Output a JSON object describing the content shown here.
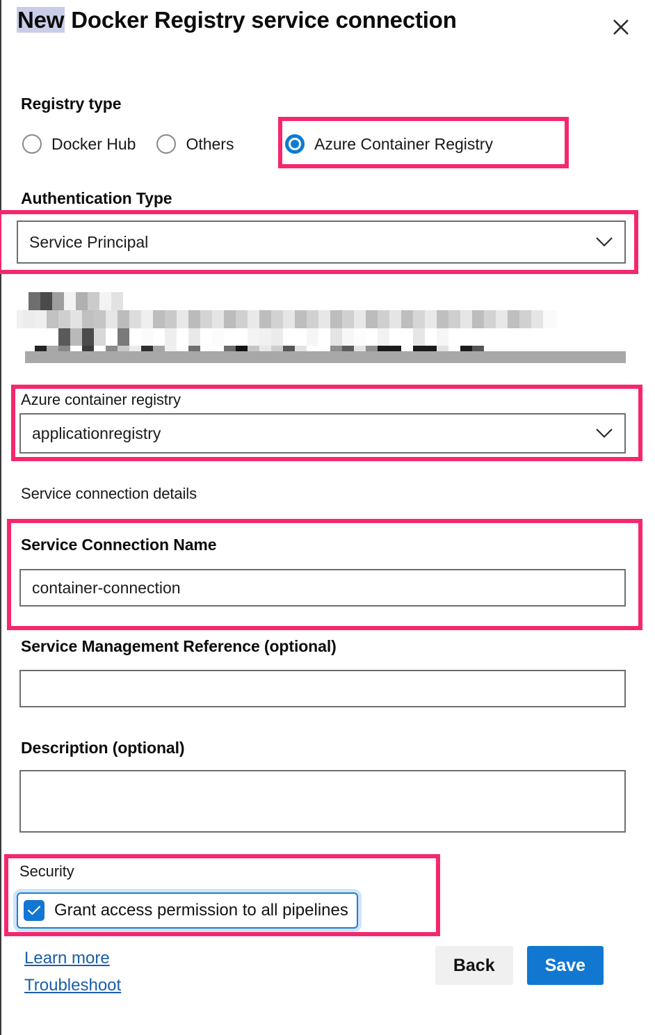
{
  "dialog": {
    "title_highlighted": "New",
    "title_rest": " Docker Registry service connection",
    "close_icon": "close-icon"
  },
  "registry_type": {
    "label": "Registry type",
    "options": [
      {
        "label": "Docker Hub",
        "selected": false
      },
      {
        "label": "Others",
        "selected": false
      },
      {
        "label": "Azure Container Registry",
        "selected": true
      }
    ]
  },
  "authentication_type": {
    "label": "Authentication Type",
    "value": "Service Principal",
    "chevron_icon": "chevron-down-icon"
  },
  "redacted_block": {
    "description": "pixelated-redacted-content"
  },
  "azure_container_registry": {
    "label": "Azure container registry",
    "value": "applicationregistry",
    "chevron_icon": "chevron-down-icon"
  },
  "service_connection_details": {
    "section_label": "Service connection details",
    "name_label": "Service Connection Name",
    "name_value": "container-connection",
    "mgmt_ref_label": "Service Management Reference (optional)",
    "mgmt_ref_value": "",
    "description_label": "Description (optional)",
    "description_value": ""
  },
  "security": {
    "label": "Security",
    "checkbox_label": "Grant access permission to all pipelines",
    "checkbox_checked": true,
    "check_icon": "check-icon"
  },
  "footer": {
    "learn_more": "Learn more",
    "troubleshoot": "Troubleshoot",
    "back_label": "Back",
    "save_label": "Save"
  },
  "colors": {
    "highlight_pink": "#f5276e",
    "accent_blue": "#1177d1",
    "selection_lavender": "#c8cde8",
    "link_blue": "#1a5ea8"
  }
}
